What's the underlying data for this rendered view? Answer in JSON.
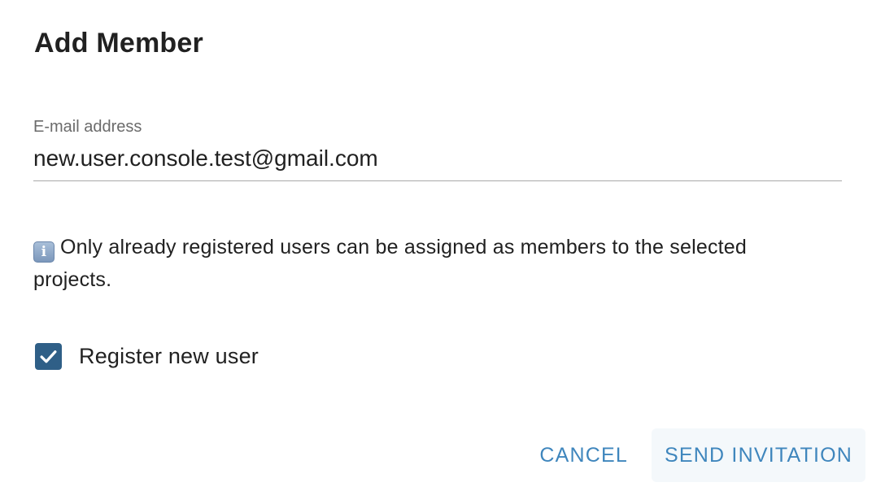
{
  "dialog": {
    "title": "Add Member"
  },
  "email_field": {
    "label": "E-mail address",
    "value": "new.user.console.test@gmail.com"
  },
  "info": {
    "icon": "info-icon",
    "icon_glyph": "i",
    "text": "Only already registered users can be assigned as members to the selected projects."
  },
  "register_checkbox": {
    "checked": true,
    "label": "Register new user",
    "color": "#2f5f87"
  },
  "actions": {
    "cancel_label": "CANCEL",
    "send_label": "SEND INVITATION",
    "accent_color": "#3f86bd"
  }
}
